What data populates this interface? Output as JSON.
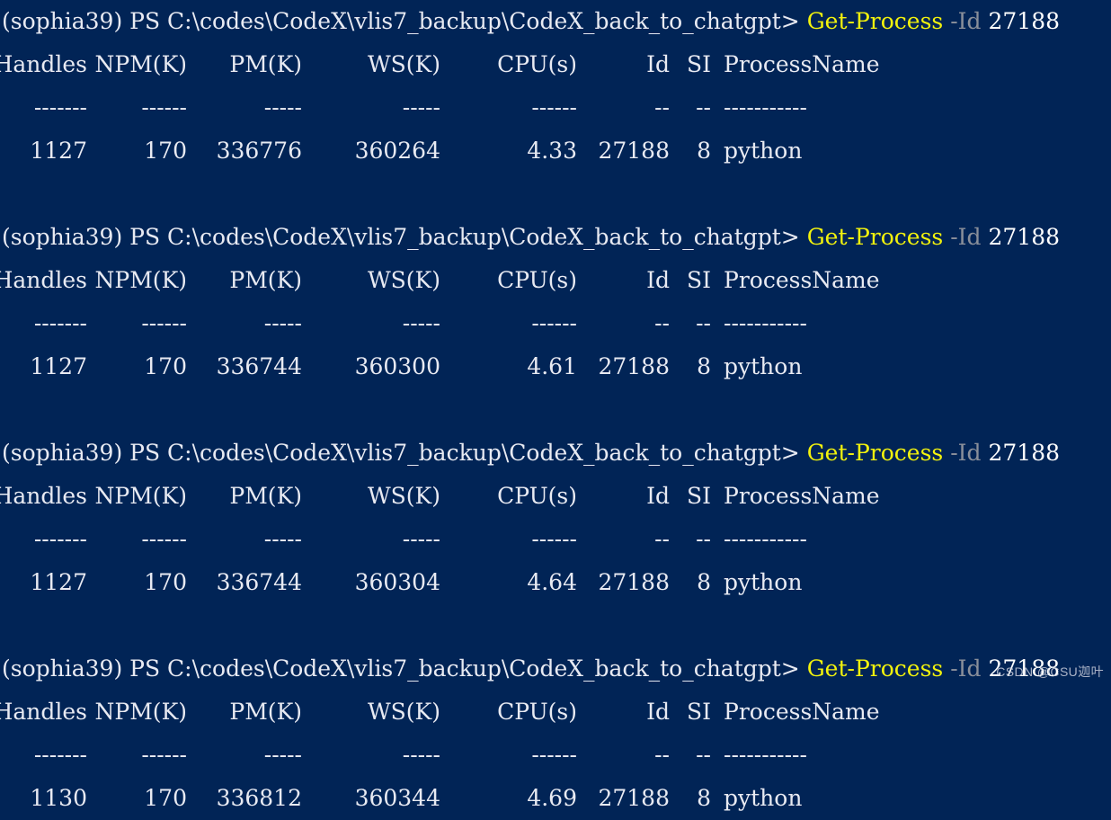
{
  "terminal": {
    "shell": "PowerShell",
    "background_color": "#012456",
    "foreground_color": "#e8eaf2",
    "command_color": "#f2f20d",
    "parameter_color": "#8a8f9a",
    "argument_color": "#ffffff",
    "prompt": {
      "env": "(sophia39)",
      "shell_tag": "PS",
      "path": "C:\\codes\\CodeX\\vlis7_backup\\CodeX_back_to_chatgpt",
      "caret": ">",
      "full_prefix": "(sophia39) PS C:\\codes\\CodeX\\vlis7_backup\\CodeX_back_to_chatgpt> "
    },
    "command": {
      "name": "Get-Process",
      "parameter": "-Id",
      "argument": "27188",
      "full": "Get-Process -Id 27188"
    },
    "table": {
      "headers": [
        "Handles",
        "NPM(K)",
        "PM(K)",
        "WS(K)",
        "CPU(s)",
        "Id",
        "SI",
        "ProcessName"
      ],
      "rules": [
        "-------",
        "------",
        "-----",
        "-----",
        "------",
        "--",
        "--",
        "-----------"
      ]
    },
    "blocks": [
      {
        "values": [
          "1127",
          "170",
          "336776",
          "360264",
          "4.33",
          "27188",
          "8",
          "python"
        ]
      },
      {
        "values": [
          "1127",
          "170",
          "336744",
          "360300",
          "4.61",
          "27188",
          "8",
          "python"
        ]
      },
      {
        "values": [
          "1127",
          "170",
          "336744",
          "360304",
          "4.64",
          "27188",
          "8",
          "python"
        ]
      },
      {
        "values": [
          "1130",
          "170",
          "336812",
          "360344",
          "4.69",
          "27188",
          "8",
          "python"
        ]
      }
    ]
  },
  "watermark": {
    "text": "CSDN @CSU迦叶"
  }
}
